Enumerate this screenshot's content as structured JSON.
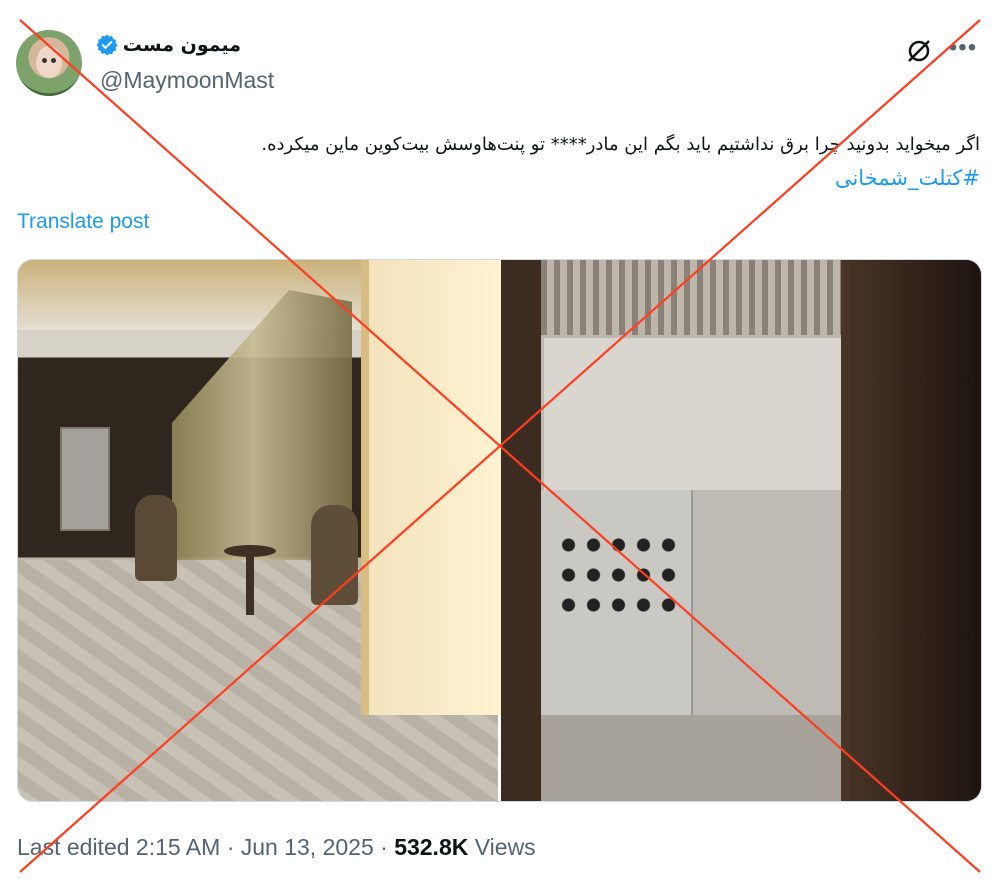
{
  "author": {
    "display_name": "میمون مست",
    "handle": "@MaymoonMast",
    "verified": true,
    "avatar_icon": "monkey-avatar"
  },
  "post": {
    "text": "اگر میخواید بدونید چرا برق نداشتیم باید بگم این مادر**** تو پنت‌هاوسش بیت‌کوین ماین میکرده.",
    "hashtag": "#کتلت_شمخانی",
    "translate_label": "Translate post"
  },
  "meta": {
    "edited_time": "Last edited 2:15 AM · Jun 13, 2025 · ",
    "views_count": "532.8K",
    "views_label": " Views"
  },
  "icons": {
    "verified": "verified-badge-icon",
    "grok": "grok-icon",
    "more": "more-options-icon"
  },
  "colors": {
    "accent": "#1d9bf0",
    "cross": "#ff3d1f"
  }
}
